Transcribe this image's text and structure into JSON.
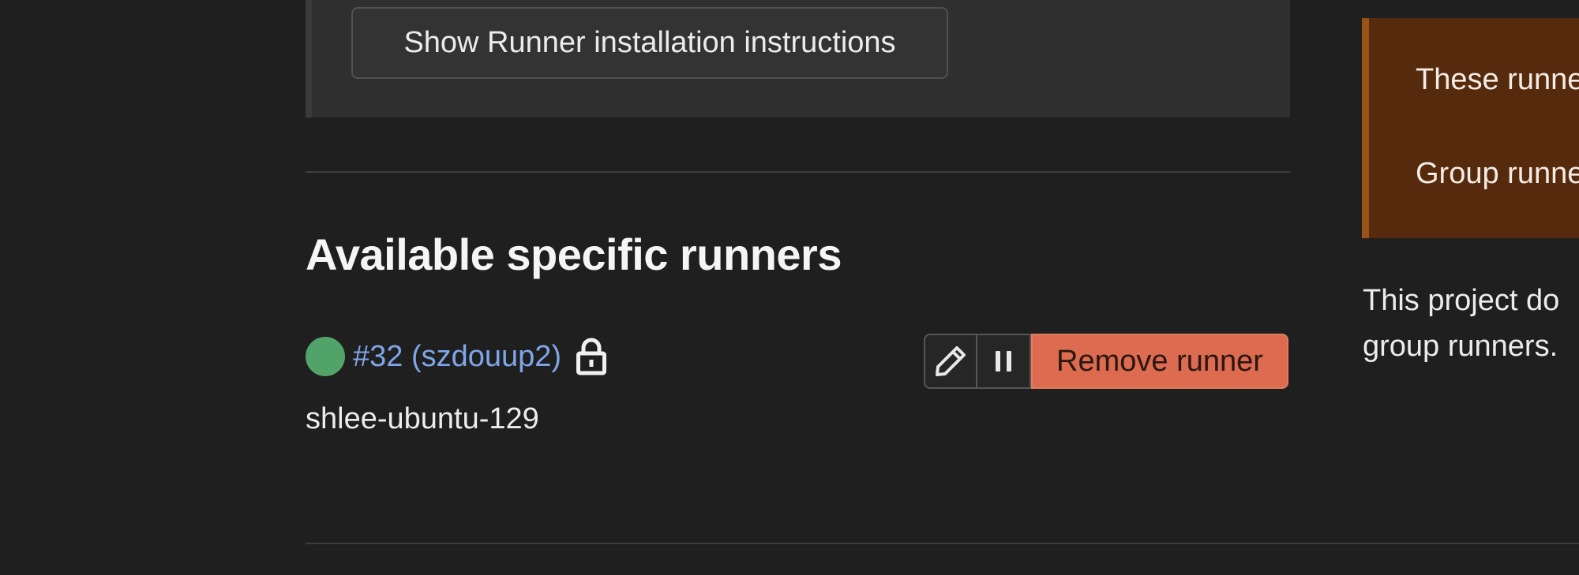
{
  "install": {
    "button_label": "Show Runner installation instructions"
  },
  "specific_runners": {
    "heading": "Available specific runners",
    "runner": {
      "status": "online",
      "status_color": "#52a36a",
      "link_text": "#32 (szdouup2)",
      "locked": true,
      "description": "shlee-ubuntu-129"
    },
    "actions": {
      "edit_icon": "pencil-icon",
      "pause_icon": "pause-icon",
      "remove_label": "Remove runner"
    }
  },
  "group_runners_panel": {
    "alert_line_1": "These runne",
    "alert_line_2": "Group runne",
    "text_line_1": "This project do",
    "text_line_2": "group runners."
  },
  "colors": {
    "background": "#1f1f1f",
    "link": "#7fa6e8",
    "danger": "#dc6b4f",
    "warning_bg": "#562a0c"
  }
}
